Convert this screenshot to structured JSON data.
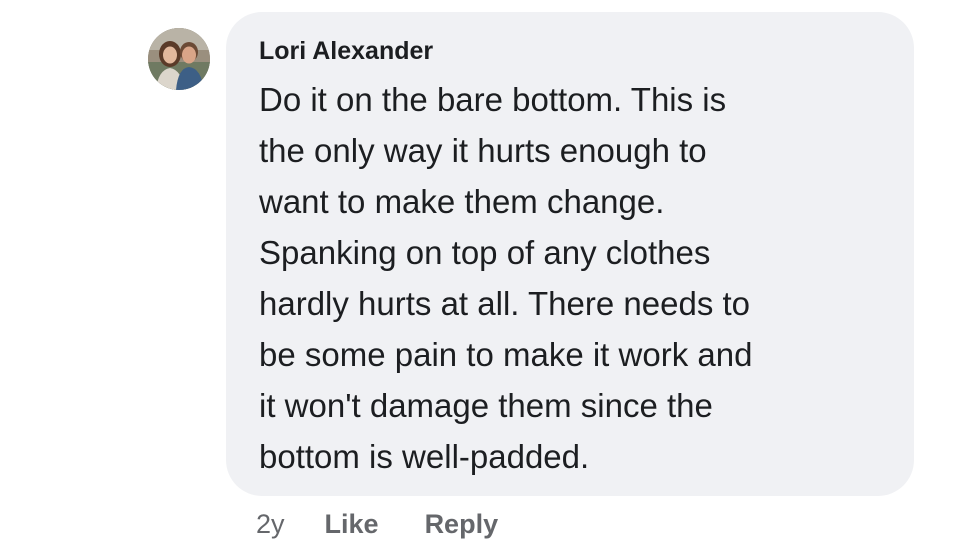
{
  "comment": {
    "author": "Lori Alexander",
    "lines": [
      "Do it on the bare bottom. This is",
      "the only way it hurts enough to",
      "want to make them change.",
      "Spanking on top of any clothes",
      "hardly hurts at all. There needs to",
      "be some pain to make it work and",
      "it won't damage them since the",
      "bottom is well-padded."
    ],
    "time": "2y",
    "like_label": "Like",
    "reply_label": "Reply"
  },
  "colors": {
    "bubble": "#f0f1f4",
    "text": "#1c1e21",
    "meta": "#65676b"
  },
  "icons": {
    "avatar": "profile-photo"
  }
}
